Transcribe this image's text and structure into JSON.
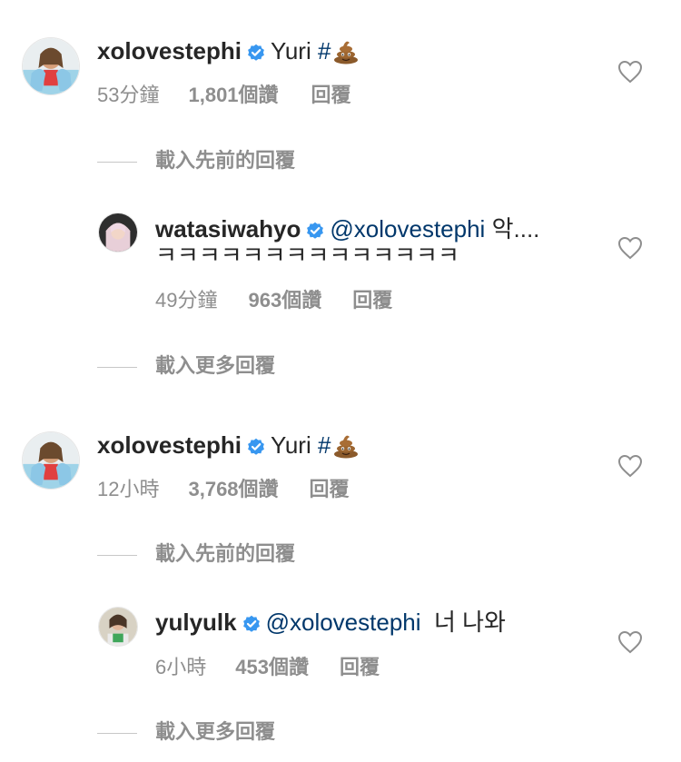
{
  "comments": [
    {
      "username": "xolovestephi",
      "text": "Yuri",
      "hashtag": "#",
      "emoji": "poo-emoji",
      "time": "53分鐘",
      "likes": "1,801個讚",
      "reply": "回覆",
      "load_more": "載入先前的回覆",
      "reply_item": {
        "username": "watasiwahyo",
        "mention": "@xolovestephi",
        "text_line1": "악....",
        "text_line2": "ㅋㅋㅋㅋㅋㅋㅋㅋㅋㅋㅋㅋㅋㅋ",
        "time": "49分鐘",
        "likes": "963個讚",
        "reply": "回覆",
        "load_more": "載入更多回覆"
      }
    },
    {
      "username": "xolovestephi",
      "text": "Yuri",
      "hashtag": "#",
      "emoji": "poo-emoji",
      "time": "12小時",
      "likes": "3,768個讚",
      "reply": "回覆",
      "load_more": "載入先前的回覆",
      "reply_item": {
        "username": "yulyulk",
        "mention": "@xolovestephi",
        "text_line1": "너 나와",
        "time": "6小時",
        "likes": "453個讚",
        "reply": "回覆",
        "load_more": "載入更多回覆"
      }
    }
  ],
  "colors": {
    "verified_badge": "#3897f0",
    "mention": "#00376b",
    "meta": "#8e8e8e"
  },
  "icons": {
    "like": "heart-outline-icon",
    "verified": "verified-badge-icon"
  }
}
